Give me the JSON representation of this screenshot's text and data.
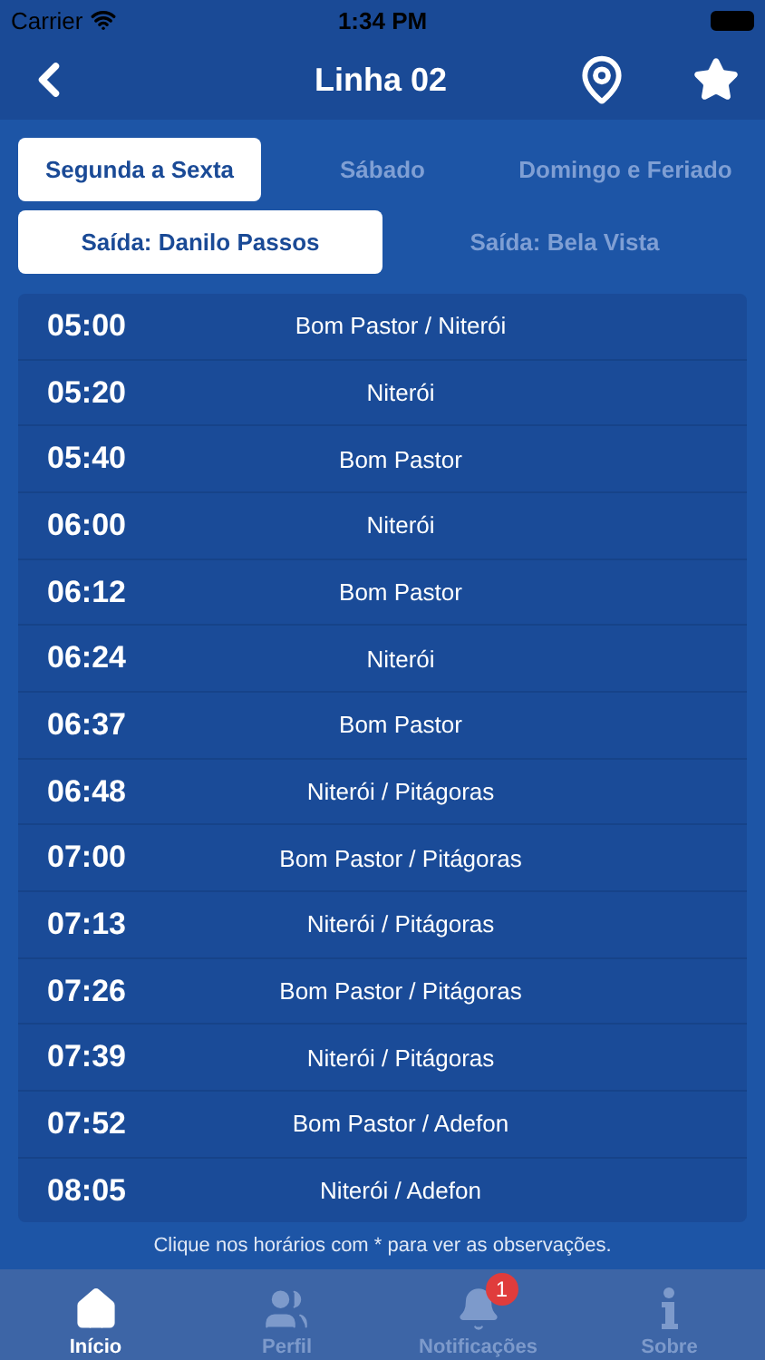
{
  "status_bar": {
    "carrier": "Carrier",
    "time": "1:34 PM"
  },
  "nav": {
    "title": "Linha 02"
  },
  "day_tabs": [
    {
      "label": "Segunda a Sexta",
      "selected": true
    },
    {
      "label": "Sábado",
      "selected": false
    },
    {
      "label": "Domingo e Feriado",
      "selected": false
    }
  ],
  "direction_tabs": [
    {
      "label": "Saída: Danilo Passos",
      "selected": true
    },
    {
      "label": "Saída: Bela Vista",
      "selected": false
    }
  ],
  "schedule": [
    {
      "time": "05:00",
      "route": "Bom Pastor / Niterói"
    },
    {
      "time": "05:20",
      "route": "Niterói"
    },
    {
      "time": "05:40",
      "route": "Bom Pastor"
    },
    {
      "time": "06:00",
      "route": "Niterói"
    },
    {
      "time": "06:12",
      "route": "Bom Pastor"
    },
    {
      "time": "06:24",
      "route": "Niterói"
    },
    {
      "time": "06:37",
      "route": "Bom Pastor"
    },
    {
      "time": "06:48",
      "route": "Niterói / Pitágoras"
    },
    {
      "time": "07:00",
      "route": "Bom Pastor / Pitágoras"
    },
    {
      "time": "07:13",
      "route": "Niterói / Pitágoras"
    },
    {
      "time": "07:26",
      "route": "Bom Pastor / Pitágoras"
    },
    {
      "time": "07:39",
      "route": "Niterói / Pitágoras"
    },
    {
      "time": "07:52",
      "route": "Bom Pastor / Adefon"
    },
    {
      "time": "08:05",
      "route": "Niterói / Adefon"
    }
  ],
  "footnote": "Clique nos horários com * para ver as observações.",
  "tab_bar": [
    {
      "kind": "home",
      "label": "Início",
      "selected": true
    },
    {
      "kind": "users",
      "label": "Perfil",
      "selected": false
    },
    {
      "kind": "bell",
      "label": "Notificações",
      "selected": false,
      "badge": "1"
    },
    {
      "kind": "info",
      "label": "Sobre",
      "selected": false
    }
  ]
}
